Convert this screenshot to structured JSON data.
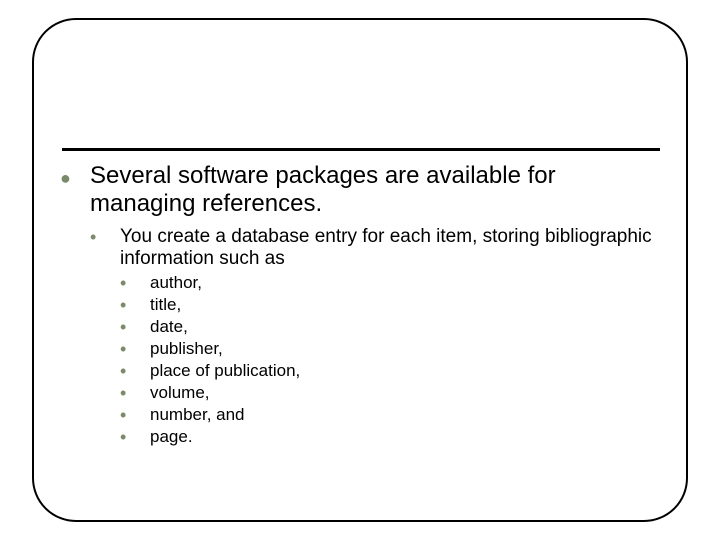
{
  "slide": {
    "level1_text": "Several software packages are available for managing references.",
    "level2_text": "You create a database entry for each item, storing bibliographic information such as",
    "level3_items": [
      "author,",
      "title,",
      "date,",
      "publisher,",
      "place of publication,",
      "volume,",
      "number, and",
      "page."
    ],
    "bullets": {
      "lvl1": "●",
      "lvl2": "•",
      "lvl3": "•"
    }
  }
}
